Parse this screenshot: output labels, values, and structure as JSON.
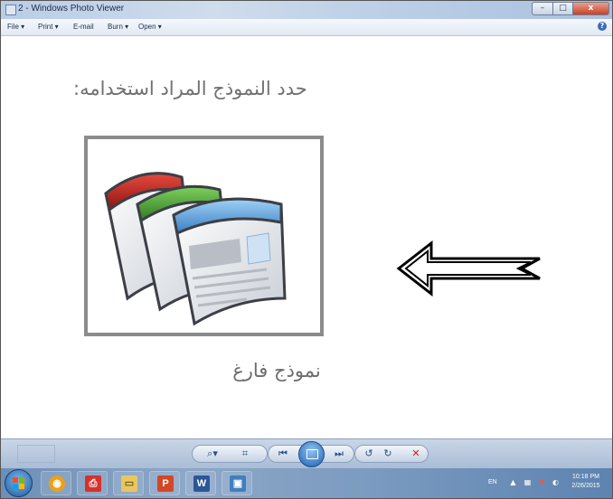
{
  "window": {
    "title": "2 - Windows Photo Viewer",
    "minimize_glyph": "–",
    "maximize_glyph": "□",
    "close_glyph": "x"
  },
  "menu": {
    "file": "File  ▾",
    "print": "Print  ▾",
    "email": "E-mail",
    "burn": "Burn  ▾",
    "open": "Open  ▾",
    "help": "?"
  },
  "slide": {
    "title": "حدد النموذج المراد استخدامه:",
    "caption": "نموذج فارغ"
  },
  "toolbar": {
    "zoom": "⌕▾",
    "fit": "⌗",
    "prev": "⏮",
    "next": "⏭",
    "rotate_ccw": "↺",
    "rotate_cw": "↻",
    "delete": "✕"
  },
  "taskbar": {
    "lang": "EN",
    "time": "10:18 PM",
    "date": "2/26/2015",
    "apps": [
      {
        "name": "chrome",
        "glyph": "◉",
        "color": "#e8a21a"
      },
      {
        "name": "pdf",
        "glyph": "⎙",
        "color": "#d6312b"
      },
      {
        "name": "explorer",
        "glyph": "▭",
        "color": "#e7c860"
      },
      {
        "name": "powerpoint",
        "glyph": "P",
        "color": "#d24726"
      },
      {
        "name": "word",
        "glyph": "W",
        "color": "#2b5797"
      },
      {
        "name": "photo-viewer",
        "glyph": "▣",
        "color": "#3f7fbf"
      }
    ]
  },
  "colors": {
    "border": "#8c8c8c",
    "arrow": "#000000"
  }
}
